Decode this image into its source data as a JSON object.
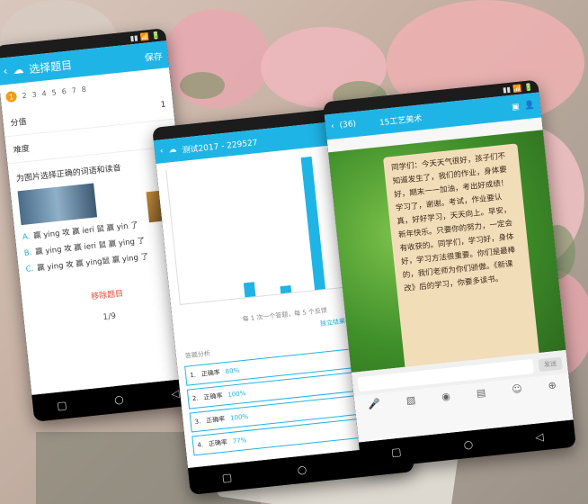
{
  "phone1": {
    "title": "选择题目",
    "save": "保存",
    "steps": [
      "1",
      "2",
      "3",
      "4",
      "5",
      "6",
      "7",
      "8"
    ],
    "rows": [
      {
        "label": "分值",
        "value": "1"
      },
      {
        "label": "难度",
        "value": ""
      }
    ],
    "question": "为图片选择正确的词语和读音",
    "options": [
      {
        "key": "A.",
        "text": "赢 ying 攻   赢 ieri 鼠   赢 yin 了"
      },
      {
        "key": "B.",
        "text": "赢 ying 攻   赢 ieri 鼠   赢 ying 了"
      },
      {
        "key": "C.",
        "text": "赢 ying 攻   赢 ying鼠   赢 ying 了"
      }
    ],
    "delete": "移除题目",
    "pager": "1/9"
  },
  "phone2": {
    "title": "测试2017 - 229527",
    "chart_caption": "每 1 次一个答题，每 5 个反馈",
    "link": "独立结果中查看答题情况",
    "section": "答题分析",
    "items": [
      {
        "n": "1.",
        "tag": "正确率",
        "pct": "80%",
        "who": ""
      },
      {
        "n": "2.",
        "tag": "正确率",
        "pct": "100%",
        "who": "左侧"
      },
      {
        "n": "3.",
        "tag": "正确率",
        "pct": "100%",
        "who": "左侧"
      },
      {
        "n": "4.",
        "tag": "正确率",
        "pct": "77%",
        "who": ""
      }
    ]
  },
  "phone3": {
    "back": "(36)",
    "title": "15工艺美术",
    "note": "同学们：今天天气很好，孩子们不知道发生了，我们的作业，身体要好，期末一一加油，考出好成绩！学习了，谢谢。考试，作业要认真，好好学习，天天向上。早安，新年快乐。只要你的努力，一定会有收获的。同学们，学习好，身体好，学习方法很重要。你们是最棒的，我们老师为你们骄傲。《新课改》后的学习，你要多读书。",
    "send": "发送"
  }
}
